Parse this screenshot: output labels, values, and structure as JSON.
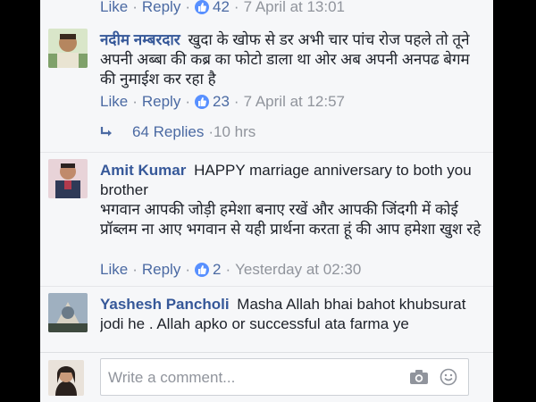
{
  "comments": [
    {
      "actions": {
        "like": "Like",
        "reply": "Reply",
        "count": "42",
        "time": "7 April at 13:01"
      }
    },
    {
      "author": "नदीम नम्बरदार",
      "text": "खुदा के खोफ से डर अभी चार पांच रोज पहले तो तूने अपनी अब्बा की कब्र का फोटो डाला था ओर अब अपनी अनपढ बेगम की नुमाईश कर रहा है",
      "actions": {
        "like": "Like",
        "reply": "Reply",
        "count": "23",
        "time": "7 April at 12:57"
      },
      "replies": {
        "label": "64 Replies",
        "time": "10 hrs"
      }
    },
    {
      "author": "Amit Kumar",
      "text_line1": "HAPPY marriage anniversary to both you brother",
      "text_line2": "भगवान आपकी जोड़ी हमेशा बनाए रखें और आपकी जिंदगी में कोई प्रॉब्लम ना आए भगवान से यही प्रार्थना करता हूं की आप हमेशा खुश रहे",
      "actions": {
        "like": "Like",
        "reply": "Reply",
        "count": "2",
        "time": "Yesterday at 02:30"
      }
    },
    {
      "author": "Yashesh Pancholi",
      "text": "Masha Allah bhai bahot khubsurat jodi he . Allah apko or successful ata farma ye"
    }
  ],
  "composer": {
    "placeholder": "Write a comment..."
  },
  "icons": {
    "like": "like-thumb-icon",
    "reply_arrow": "reply-arrow-icon",
    "camera": "camera-icon",
    "emoji": "emoji-icon"
  },
  "colors": {
    "link": "#4b6aa3",
    "author": "#365899",
    "like_badge": "#5890ff"
  }
}
